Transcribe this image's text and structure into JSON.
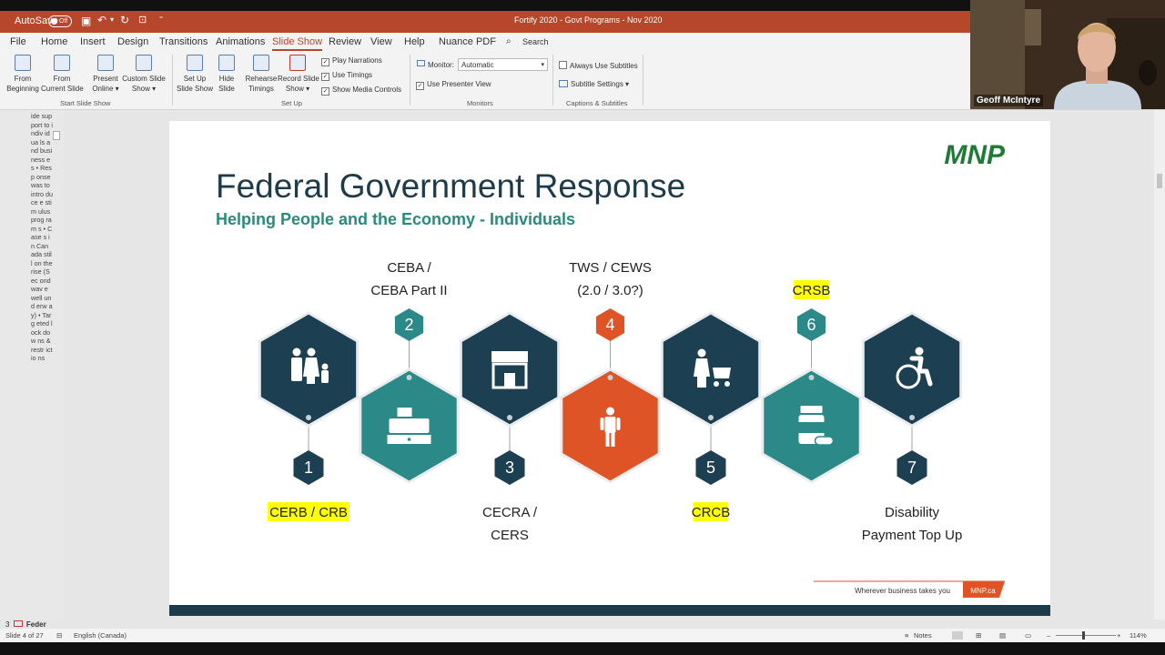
{
  "window": {
    "title": "Fortify 2020 - Govt Programs - Nov 2020",
    "autosave_label": "AutoSave",
    "autosave_state": "Off"
  },
  "tabs": [
    "File",
    "Home",
    "Insert",
    "Design",
    "Transitions",
    "Animations",
    "Slide Show",
    "Review",
    "View",
    "Help",
    "Nuance PDF"
  ],
  "active_tab": "Slide Show",
  "search_label": "Search",
  "ribbon": {
    "start_group": "Start Slide Show",
    "from_beginning": [
      "From",
      "Beginning"
    ],
    "from_current": [
      "From",
      "Current Slide"
    ],
    "present_online": [
      "Present",
      "Online ▾"
    ],
    "custom_show": [
      "Custom Slide",
      "Show ▾"
    ],
    "setup_group": "Set Up",
    "setup_show": [
      "Set Up",
      "Slide Show"
    ],
    "hide_slide": [
      "Hide",
      "Slide"
    ],
    "rehearse": [
      "Rehearse",
      "Timings"
    ],
    "record": [
      "Record Slide",
      "Show ▾"
    ],
    "play_narrations": "Play Narrations",
    "use_timings": "Use Timings",
    "show_media": "Show Media Controls",
    "monitors_group": "Monitors",
    "monitor_label": "Monitor:",
    "monitor_value": "Automatic",
    "presenter_view": "Use Presenter View",
    "captions_group": "Captions & Subtitles",
    "always_subtitles": "Always Use Subtitles",
    "subtitle_settings": "Subtitle Settings ▾"
  },
  "webcam": {
    "name": "Geoff McIntyre"
  },
  "outline_text": "ide sup port to indiv idua ls and busi ness es • Resp onse was to intro duce e stim ulus prog ram s • Case s in Can ada still on the rise (Sec ond wav e well und erw ay) • Targ eted lock dow ns & restr ictio ns",
  "thumb": {
    "number": "3",
    "label": "Feder"
  },
  "slide": {
    "logo": "MNP",
    "title": "Federal Government Response",
    "subtitle": "Helping People and the Economy - Individuals",
    "footer_tagline": "Wherever business takes you",
    "footer_url": "MNP.ca",
    "items": [
      {
        "num": "1",
        "label_lines": [
          "CERB / CRB"
        ],
        "highlight": true,
        "color": "#1c3f51",
        "icon": "family-icon"
      },
      {
        "num": "2",
        "label_lines": [
          "CEBA /",
          "CEBA Part II"
        ],
        "highlight": false,
        "color": "#2b8a87",
        "icon": "cash-register-icon"
      },
      {
        "num": "3",
        "label_lines": [
          "CECRA /",
          "CERS"
        ],
        "highlight": false,
        "color": "#1c3f51",
        "icon": "storefront-icon"
      },
      {
        "num": "4",
        "label_lines": [
          "TWS / CEWS",
          "(2.0 / 3.0?)"
        ],
        "highlight": false,
        "color": "#df5426",
        "icon": "person-icon"
      },
      {
        "num": "5",
        "label_lines": [
          "CRCB"
        ],
        "highlight": true,
        "color": "#1c3f51",
        "icon": "parent-stroller-icon"
      },
      {
        "num": "6",
        "label_lines": [
          "CRSB"
        ],
        "highlight": true,
        "color": "#2b8a87",
        "icon": "medicine-icon"
      },
      {
        "num": "7",
        "label_lines": [
          "Disability",
          "Payment Top Up"
        ],
        "highlight": false,
        "color": "#1c3f51",
        "icon": "wheelchair-icon"
      }
    ]
  },
  "status": {
    "slide_count": "Slide 4 of 27",
    "language": "English (Canada)",
    "notes": "Notes",
    "zoom": "114%"
  }
}
